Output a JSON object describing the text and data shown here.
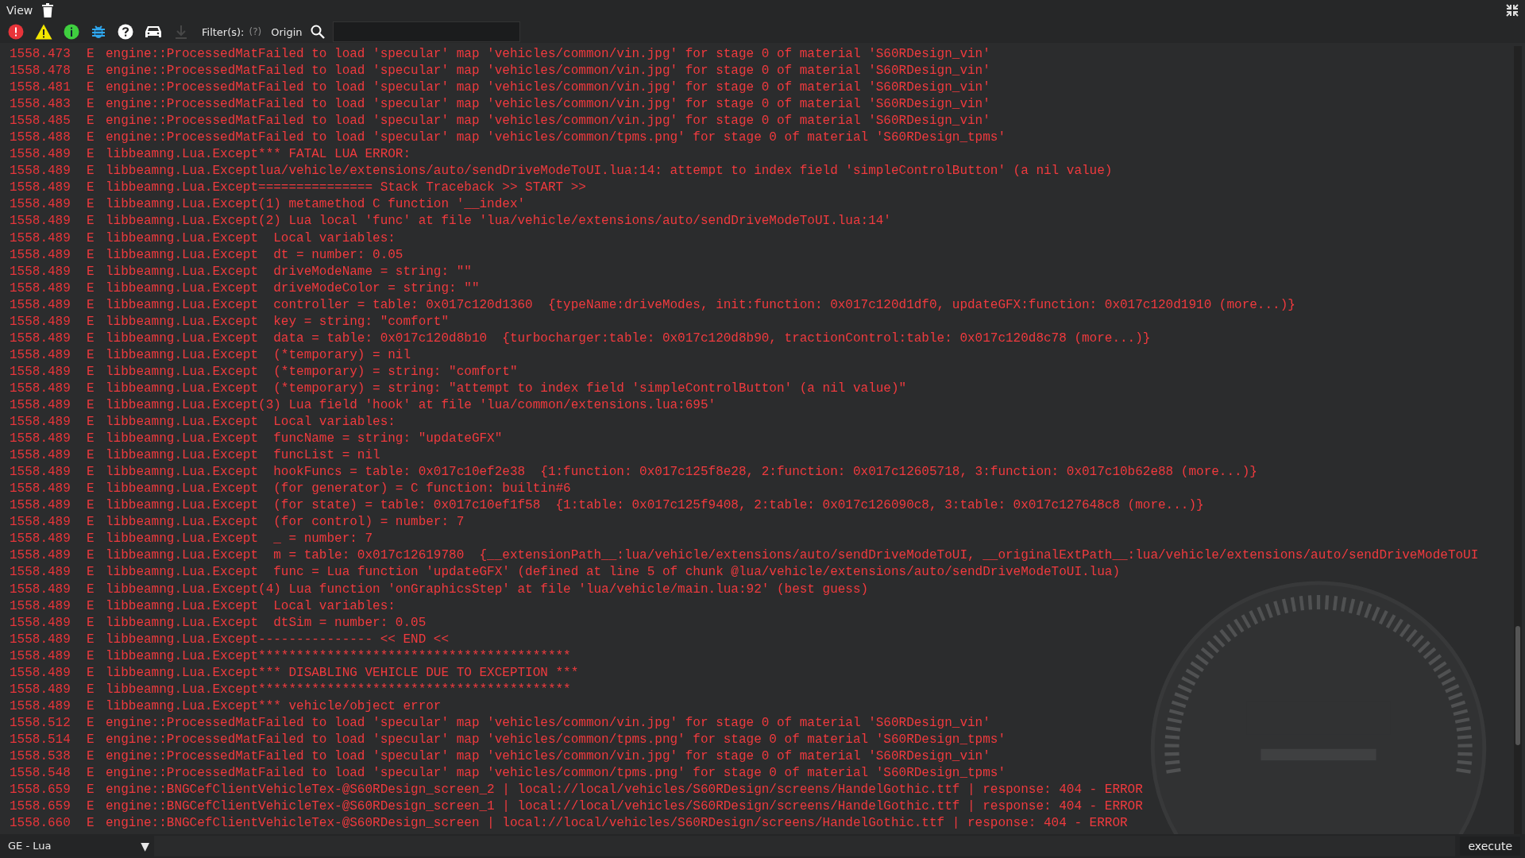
{
  "menu": {
    "label": "View"
  },
  "toolbar": {
    "buttons": [
      {
        "kind": "error",
        "disabled": false
      },
      {
        "kind": "warning",
        "disabled": false
      },
      {
        "kind": "info",
        "disabled": false
      },
      {
        "kind": "debug",
        "disabled": false
      },
      {
        "kind": "help",
        "disabled": false
      },
      {
        "kind": "vehicle",
        "disabled": false
      },
      {
        "kind": "download",
        "disabled": true
      }
    ],
    "filter_label": "Filter(s):",
    "filter_hint": "(?)",
    "origin_label": "Origin"
  },
  "log": [
    {
      "time": "1558.473",
      "level": "E",
      "message": "engine::ProcessedMatFailed to load 'specular' map 'vehicles/common/vin.jpg' for stage 0 of material 'S60RDesign_vin'"
    },
    {
      "time": "1558.478",
      "level": "E",
      "message": "engine::ProcessedMatFailed to load 'specular' map 'vehicles/common/vin.jpg' for stage 0 of material 'S60RDesign_vin'"
    },
    {
      "time": "1558.481",
      "level": "E",
      "message": "engine::ProcessedMatFailed to load 'specular' map 'vehicles/common/vin.jpg' for stage 0 of material 'S60RDesign_vin'"
    },
    {
      "time": "1558.483",
      "level": "E",
      "message": "engine::ProcessedMatFailed to load 'specular' map 'vehicles/common/vin.jpg' for stage 0 of material 'S60RDesign_vin'"
    },
    {
      "time": "1558.485",
      "level": "E",
      "message": "engine::ProcessedMatFailed to load 'specular' map 'vehicles/common/vin.jpg' for stage 0 of material 'S60RDesign_vin'"
    },
    {
      "time": "1558.488",
      "level": "E",
      "message": "engine::ProcessedMatFailed to load 'specular' map 'vehicles/common/tpms.png' for stage 0 of material 'S60RDesign_tpms'"
    },
    {
      "time": "1558.489",
      "level": "E",
      "message": "libbeamng.Lua.Except*** FATAL LUA ERROR:"
    },
    {
      "time": "1558.489",
      "level": "E",
      "message": "libbeamng.Lua.Exceptlua/vehicle/extensions/auto/sendDriveModeToUI.lua:14: attempt to index field 'simpleControlButton' (a nil value)"
    },
    {
      "time": "1558.489",
      "level": "E",
      "message": "libbeamng.Lua.Except=============== Stack Traceback >> START >>"
    },
    {
      "time": "1558.489",
      "level": "E",
      "message": "libbeamng.Lua.Except(1) metamethod C function '__index'"
    },
    {
      "time": "1558.489",
      "level": "E",
      "message": "libbeamng.Lua.Except(2) Lua local 'func' at file 'lua/vehicle/extensions/auto/sendDriveModeToUI.lua:14'"
    },
    {
      "time": "1558.489",
      "level": "E",
      "message": "libbeamng.Lua.Except  Local variables:"
    },
    {
      "time": "1558.489",
      "level": "E",
      "message": "libbeamng.Lua.Except  dt = number: 0.05"
    },
    {
      "time": "1558.489",
      "level": "E",
      "message": "libbeamng.Lua.Except  driveModeName = string: \"\""
    },
    {
      "time": "1558.489",
      "level": "E",
      "message": "libbeamng.Lua.Except  driveModeColor = string: \"\""
    },
    {
      "time": "1558.489",
      "level": "E",
      "message": "libbeamng.Lua.Except  controller = table: 0x017c120d1360  {typeName:driveModes, init:function: 0x017c120d1df0, updateGFX:function: 0x017c120d1910 (more...)}"
    },
    {
      "time": "1558.489",
      "level": "E",
      "message": "libbeamng.Lua.Except  key = string: \"comfort\""
    },
    {
      "time": "1558.489",
      "level": "E",
      "message": "libbeamng.Lua.Except  data = table: 0x017c120d8b10  {turbocharger:table: 0x017c120d8b90, tractionControl:table: 0x017c120d8c78 (more...)}"
    },
    {
      "time": "1558.489",
      "level": "E",
      "message": "libbeamng.Lua.Except  (*temporary) = nil"
    },
    {
      "time": "1558.489",
      "level": "E",
      "message": "libbeamng.Lua.Except  (*temporary) = string: \"comfort\""
    },
    {
      "time": "1558.489",
      "level": "E",
      "message": "libbeamng.Lua.Except  (*temporary) = string: \"attempt to index field 'simpleControlButton' (a nil value)\""
    },
    {
      "time": "1558.489",
      "level": "E",
      "message": "libbeamng.Lua.Except(3) Lua field 'hook' at file 'lua/common/extensions.lua:695'"
    },
    {
      "time": "1558.489",
      "level": "E",
      "message": "libbeamng.Lua.Except  Local variables:"
    },
    {
      "time": "1558.489",
      "level": "E",
      "message": "libbeamng.Lua.Except  funcName = string: \"updateGFX\""
    },
    {
      "time": "1558.489",
      "level": "E",
      "message": "libbeamng.Lua.Except  funcList = nil"
    },
    {
      "time": "1558.489",
      "level": "E",
      "message": "libbeamng.Lua.Except  hookFuncs = table: 0x017c10ef2e38  {1:function: 0x017c125f8e28, 2:function: 0x017c12605718, 3:function: 0x017c10b62e88 (more...)}"
    },
    {
      "time": "1558.489",
      "level": "E",
      "message": "libbeamng.Lua.Except  (for generator) = C function: builtin#6"
    },
    {
      "time": "1558.489",
      "level": "E",
      "message": "libbeamng.Lua.Except  (for state) = table: 0x017c10ef1f58  {1:table: 0x017c125f9408, 2:table: 0x017c126090c8, 3:table: 0x017c127648c8 (more...)}"
    },
    {
      "time": "1558.489",
      "level": "E",
      "message": "libbeamng.Lua.Except  (for control) = number: 7"
    },
    {
      "time": "1558.489",
      "level": "E",
      "message": "libbeamng.Lua.Except  _ = number: 7"
    },
    {
      "time": "1558.489",
      "level": "E",
      "message": "libbeamng.Lua.Except  m = table: 0x017c12619780  {__extensionPath__:lua/vehicle/extensions/auto/sendDriveModeToUI, __originalExtPath__:lua/vehicle/extensions/auto/sendDriveModeToUI"
    },
    {
      "time": "1558.489",
      "level": "E",
      "message": "libbeamng.Lua.Except  func = Lua function 'updateGFX' (defined at line 5 of chunk @lua/vehicle/extensions/auto/sendDriveModeToUI.lua)"
    },
    {
      "time": "1558.489",
      "level": "E",
      "message": "libbeamng.Lua.Except(4) Lua function 'onGraphicsStep' at file 'lua/vehicle/main.lua:92' (best guess)"
    },
    {
      "time": "1558.489",
      "level": "E",
      "message": "libbeamng.Lua.Except  Local variables:"
    },
    {
      "time": "1558.489",
      "level": "E",
      "message": "libbeamng.Lua.Except  dtSim = number: 0.05"
    },
    {
      "time": "1558.489",
      "level": "E",
      "message": "libbeamng.Lua.Except--------------- << END <<"
    },
    {
      "time": "1558.489",
      "level": "E",
      "message": "libbeamng.Lua.Except*****************************************"
    },
    {
      "time": "1558.489",
      "level": "E",
      "message": "libbeamng.Lua.Except*** DISABLING VEHICLE DUE TO EXCEPTION ***"
    },
    {
      "time": "1558.489",
      "level": "E",
      "message": "libbeamng.Lua.Except*****************************************"
    },
    {
      "time": "1558.489",
      "level": "E",
      "message": "libbeamng.Lua.Except*** vehicle/object error"
    },
    {
      "time": "1558.512",
      "level": "E",
      "message": "engine::ProcessedMatFailed to load 'specular' map 'vehicles/common/vin.jpg' for stage 0 of material 'S60RDesign_vin'"
    },
    {
      "time": "1558.514",
      "level": "E",
      "message": "engine::ProcessedMatFailed to load 'specular' map 'vehicles/common/tpms.png' for stage 0 of material 'S60RDesign_tpms'"
    },
    {
      "time": "1558.538",
      "level": "E",
      "message": "engine::ProcessedMatFailed to load 'specular' map 'vehicles/common/vin.jpg' for stage 0 of material 'S60RDesign_vin'"
    },
    {
      "time": "1558.548",
      "level": "E",
      "message": "engine::ProcessedMatFailed to load 'specular' map 'vehicles/common/tpms.png' for stage 0 of material 'S60RDesign_tpms'"
    },
    {
      "time": "1558.659",
      "level": "E",
      "message": "engine::BNGCefClientVehicleTex-@S60RDesign_screen_2 | local://local/vehicles/S60RDesign/screens/HandelGothic.ttf | response: 404 - ERROR"
    },
    {
      "time": "1558.659",
      "level": "E",
      "message": "engine::BNGCefClientVehicleTex-@S60RDesign_screen_1 | local://local/vehicles/S60RDesign/screens/HandelGothic.ttf | response: 404 - ERROR"
    },
    {
      "time": "1558.660",
      "level": "E",
      "message": "engine::BNGCefClientVehicleTex-@S60RDesign_screen | local://local/vehicles/S60RDesign/screens/HandelGothic.ttf | response: 404 - ERROR"
    }
  ],
  "console": {
    "context": "GE - Lua",
    "caret": "▼",
    "execute_label": "execute"
  }
}
